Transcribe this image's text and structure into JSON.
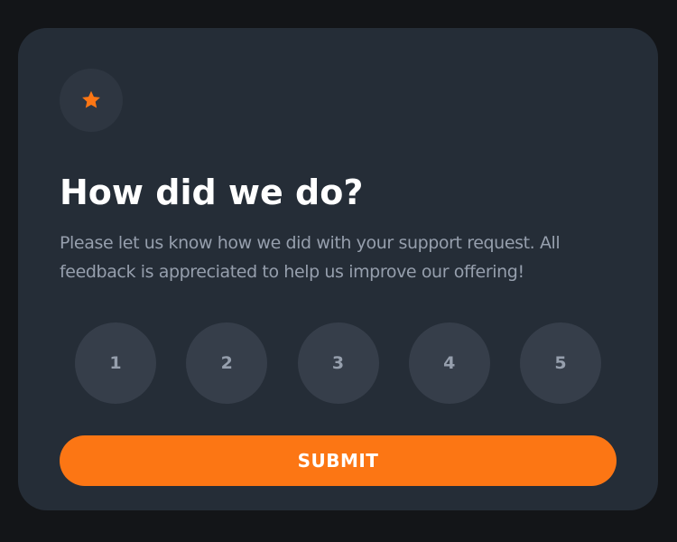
{
  "card": {
    "icon": "star-icon",
    "title": "How did we do?",
    "description": "Please let us know how we did with your support request. All feedback is appreciated to help us improve our offering!",
    "ratings": [
      "1",
      "2",
      "3",
      "4",
      "5"
    ],
    "submit_label": "SUBMIT"
  },
  "colors": {
    "page_background": "#131518",
    "card_background": "#252d37",
    "icon_circle": "#2e3641",
    "accent": "#fc7614",
    "rating_background": "#363e4a",
    "muted_text": "#969fad",
    "title_text": "#ffffff"
  }
}
